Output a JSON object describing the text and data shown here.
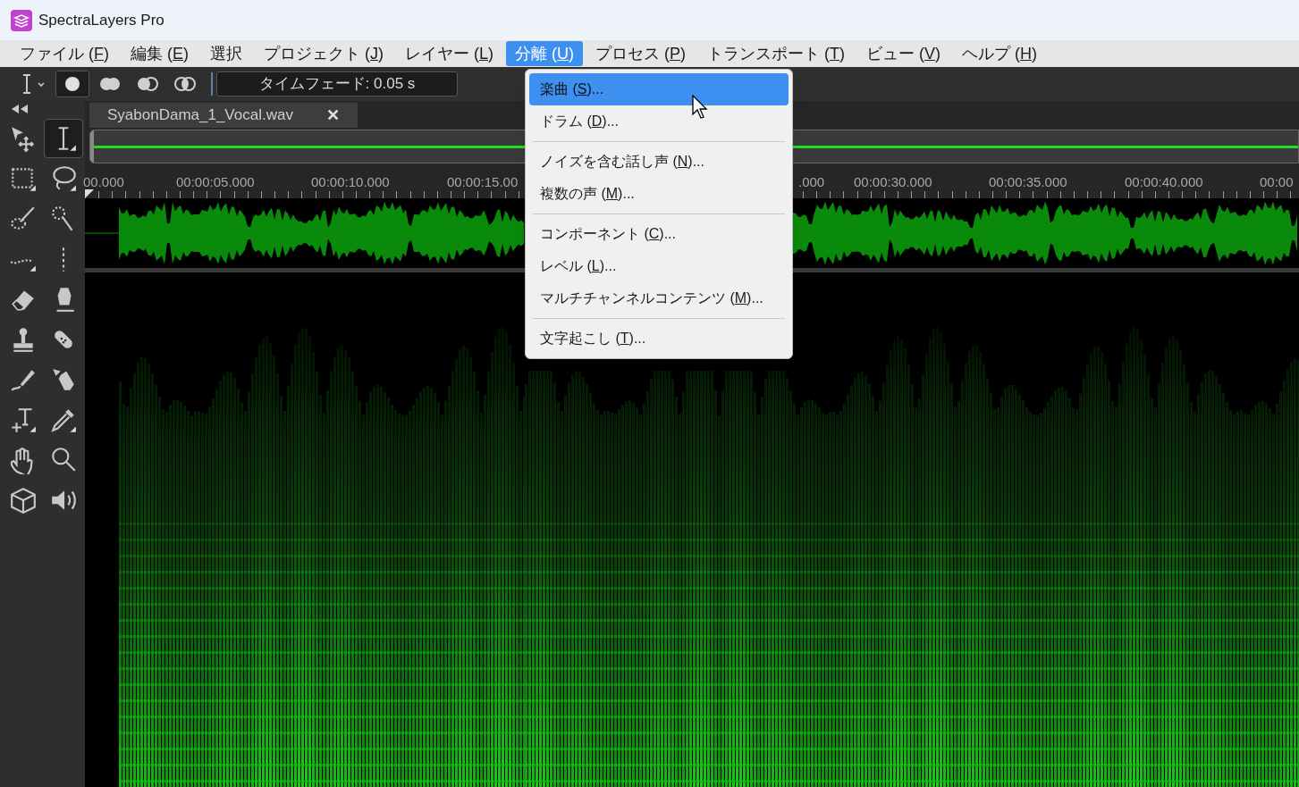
{
  "window": {
    "title": "SpectraLayers Pro"
  },
  "menu_bar": [
    {
      "label": "ファイル (",
      "key": "F",
      "suffix": ")",
      "selected": false
    },
    {
      "label": "編集 (",
      "key": "E",
      "suffix": ")",
      "selected": false
    },
    {
      "label": "選択",
      "selected": false
    },
    {
      "label": "プロジェクト (",
      "key": "J",
      "suffix": ")",
      "selected": false
    },
    {
      "label": "レイヤー (",
      "key": "L",
      "suffix": ")",
      "selected": false
    },
    {
      "label": "分離 (",
      "key": "U",
      "suffix": ")",
      "selected": true
    },
    {
      "label": "プロセス (",
      "key": "P",
      "suffix": ")",
      "selected": false
    },
    {
      "label": "トランスポート (",
      "key": "T",
      "suffix": ")",
      "selected": false
    },
    {
      "label": "ビュー (",
      "key": "V",
      "suffix": ")",
      "selected": false
    },
    {
      "label": "ヘルプ (",
      "key": "H",
      "suffix": ")",
      "selected": false
    }
  ],
  "toolbar": {
    "modes": [
      {
        "selected": true
      },
      {
        "selected": false
      },
      {
        "selected": false
      },
      {
        "selected": false
      }
    ],
    "time_fade": "タイムフェード: 0.05 s"
  },
  "tools": [
    {
      "selected": false
    },
    {
      "selected": true
    },
    {
      "selected": false
    },
    {
      "selected": false
    },
    {
      "selected": false
    },
    {
      "selected": false
    },
    {
      "selected": false
    },
    {
      "selected": false
    },
    {
      "selected": false
    },
    {
      "selected": false
    },
    {
      "selected": false
    },
    {
      "selected": false
    },
    {
      "selected": false
    },
    {
      "selected": false
    },
    {
      "selected": false
    },
    {
      "selected": false
    },
    {
      "selected": false
    },
    {
      "selected": false
    },
    {
      "selected": false
    },
    {
      "selected": false
    }
  ],
  "document_tab": {
    "title": "SyabonDama_1_Vocal.wav",
    "close": "✕"
  },
  "ruler": {
    "labels": [
      "00.000",
      "00:00:05.000",
      "00:00:10.000",
      "00:00:15.00",
      ".000",
      "00:00:30.000",
      "00:00:35.000",
      "00:00:40.000",
      "00:00"
    ]
  },
  "dropdown": [
    {
      "kind": "item",
      "label": "楽曲 (",
      "key": "S",
      "suffix": ")...",
      "selected": true
    },
    {
      "kind": "item",
      "label": "ドラム (",
      "key": "D",
      "suffix": ")...",
      "selected": false
    },
    {
      "kind": "separator"
    },
    {
      "kind": "item",
      "label": "ノイズを含む話し声 (",
      "key": "N",
      "suffix": ")...",
      "selected": false
    },
    {
      "kind": "item",
      "label": "複数の声 (",
      "key": "M",
      "suffix": ")...",
      "selected": false
    },
    {
      "kind": "separator"
    },
    {
      "kind": "item",
      "label": "コンポーネント (",
      "key": "C",
      "suffix": ")...",
      "selected": false
    },
    {
      "kind": "item",
      "label": "レベル (",
      "key": "L",
      "suffix": ")...",
      "selected": false
    },
    {
      "kind": "item",
      "label": "マルチチャンネルコンテンツ (",
      "key": "M",
      "suffix": ")...",
      "selected": false
    },
    {
      "kind": "separator"
    },
    {
      "kind": "item",
      "label": "文字起こし (",
      "key": "T",
      "suffix": ")...",
      "selected": false
    }
  ]
}
